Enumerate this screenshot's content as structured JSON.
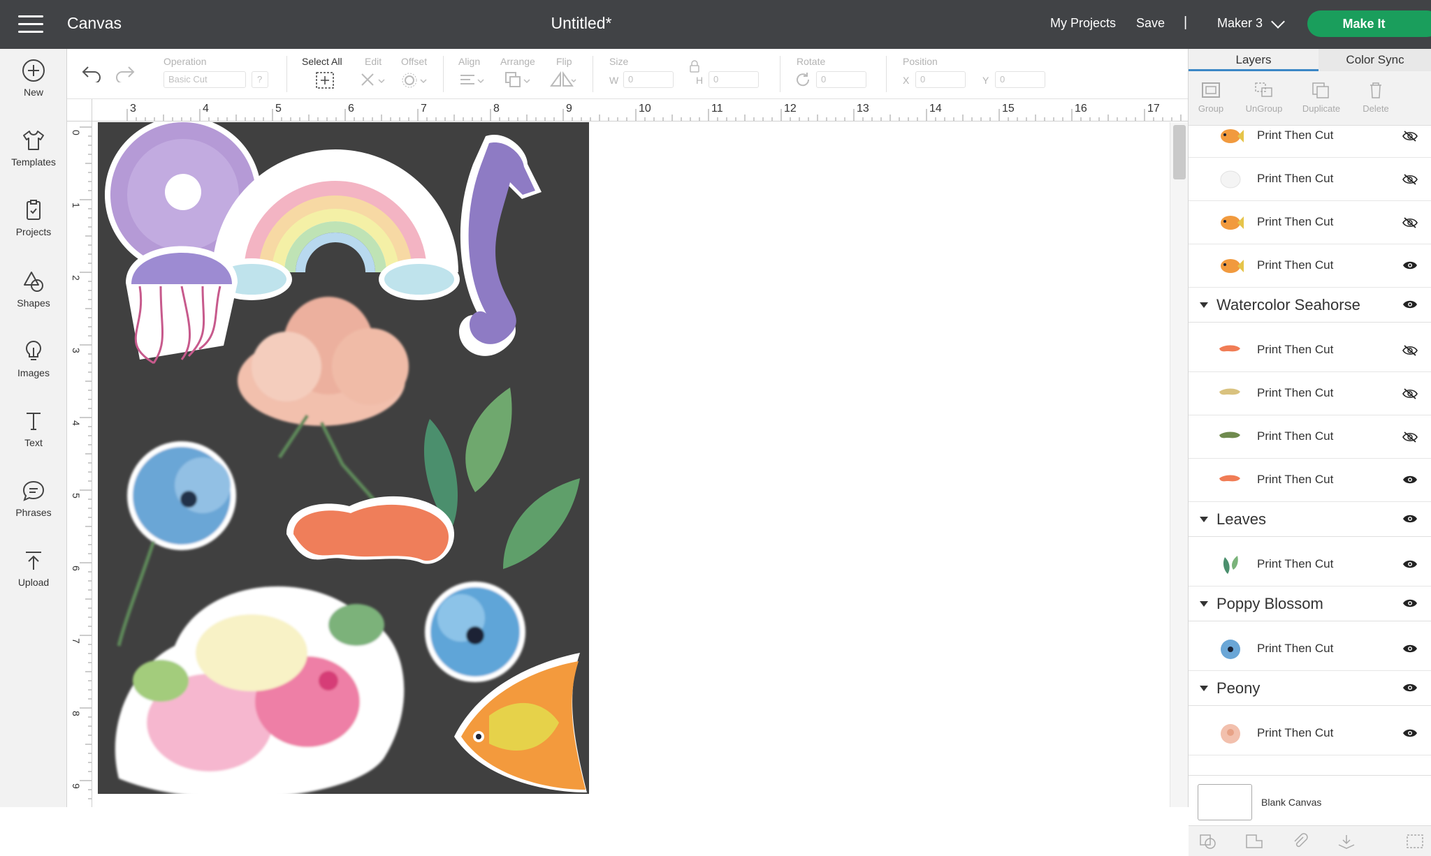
{
  "topbar": {
    "app_title": "Canvas",
    "doc_title": "Untitled*",
    "my_projects": "My Projects",
    "save": "Save",
    "separator": "|",
    "machine": "Maker 3",
    "make_it": "Make It"
  },
  "sidebar": {
    "items": [
      {
        "label": "New",
        "icon": "plus-circle-icon"
      },
      {
        "label": "Templates",
        "icon": "shirt-icon"
      },
      {
        "label": "Projects",
        "icon": "projects-icon"
      },
      {
        "label": "Shapes",
        "icon": "shapes-icon"
      },
      {
        "label": "Images",
        "icon": "lightbulb-icon"
      },
      {
        "label": "Text",
        "icon": "text-icon"
      },
      {
        "label": "Phrases",
        "icon": "speech-bubble-icon"
      },
      {
        "label": "Upload",
        "icon": "upload-icon"
      }
    ]
  },
  "toolbar": {
    "operation_label": "Operation",
    "operation_value": "Basic Cut",
    "help": "?",
    "select_all": "Select All",
    "edit": "Edit",
    "offset": "Offset",
    "align": "Align",
    "arrange": "Arrange",
    "flip": "Flip",
    "size": "Size",
    "w_label": "W",
    "w_value": "0",
    "h_label": "H",
    "h_value": "0",
    "rotate": "Rotate",
    "rotate_value": "0",
    "position": "Position",
    "x_label": "X",
    "x_value": "0",
    "y_label": "Y",
    "y_value": "0"
  },
  "ruler": {
    "h_ticks": [
      "3",
      "4",
      "5",
      "6",
      "7",
      "8",
      "9",
      "10",
      "11",
      "12",
      "13",
      "14",
      "15",
      "16",
      "17"
    ],
    "v_ticks": [
      "0",
      "1",
      "2",
      "3",
      "4",
      "5",
      "6",
      "7",
      "8",
      "9"
    ]
  },
  "panel": {
    "tabs": [
      "Layers",
      "Color Sync"
    ],
    "tools": [
      "Group",
      "UnGroup",
      "Duplicate",
      "Delete"
    ],
    "rows": [
      {
        "type": "layer",
        "label": "Print Then Cut",
        "hidden": true,
        "thumb": "fish"
      },
      {
        "type": "layer",
        "label": "Print Then Cut",
        "hidden": true,
        "thumb": "white"
      },
      {
        "type": "layer",
        "label": "Print Then Cut",
        "hidden": true,
        "thumb": "fish"
      },
      {
        "type": "layer",
        "label": "Print Then Cut",
        "hidden": false,
        "thumb": "fish"
      },
      {
        "type": "group",
        "label": "Watercolor Seahorse"
      },
      {
        "type": "layer",
        "label": "Print Then Cut",
        "hidden": true,
        "thumb": "seahorse-orange"
      },
      {
        "type": "layer",
        "label": "Print Then Cut",
        "hidden": true,
        "thumb": "seahorse-tan"
      },
      {
        "type": "layer",
        "label": "Print Then Cut",
        "hidden": true,
        "thumb": "seahorse-green"
      },
      {
        "type": "layer",
        "label": "Print Then Cut",
        "hidden": false,
        "thumb": "seahorse-orange"
      },
      {
        "type": "group",
        "label": "Leaves"
      },
      {
        "type": "layer",
        "label": "Print Then Cut",
        "hidden": false,
        "thumb": "leaves"
      },
      {
        "type": "group",
        "label": "Poppy Blossom"
      },
      {
        "type": "layer",
        "label": "Print Then Cut",
        "hidden": false,
        "thumb": "poppy"
      },
      {
        "type": "group",
        "label": "Peony"
      },
      {
        "type": "layer",
        "label": "Print Then Cut",
        "hidden": false,
        "thumb": "peony"
      }
    ],
    "blank_canvas": "Blank Canvas"
  },
  "colors": {
    "topbar": "#414346",
    "make_it": "#1a9e5c",
    "mat": "#404040",
    "active_tab": "#3b87c6"
  }
}
